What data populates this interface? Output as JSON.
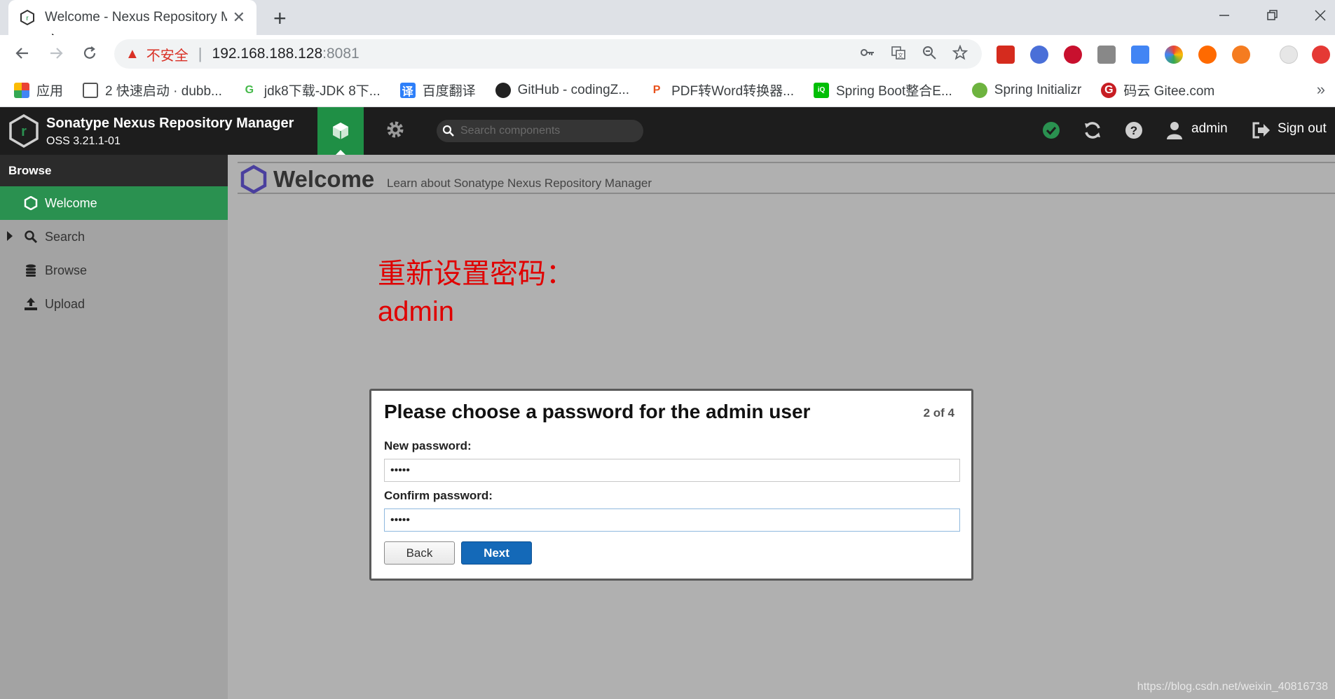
{
  "browser": {
    "tab_title": "Welcome - Nexus Repository M",
    "new_tab_symbol": "+",
    "close_symbol": "✕",
    "insecure_label": "不安全",
    "url_host": "192.168.188.128",
    "url_port": ":8081",
    "bookmarks": [
      {
        "label": "应用",
        "icon": "apps-grid-icon"
      },
      {
        "label": "2 快速启动 · dubb...",
        "icon": "book-icon"
      },
      {
        "label": "jdk8下载-JDK 8下...",
        "icon": "g-logo-icon"
      },
      {
        "label": "百度翻译",
        "icon": "translate-icon"
      },
      {
        "label": "GitHub - codingZ...",
        "icon": "github-icon"
      },
      {
        "label": "PDF转Word转换器...",
        "icon": "pdf-icon"
      },
      {
        "label": "Spring Boot整合E...",
        "icon": "iqiyi-icon"
      },
      {
        "label": "Spring Initializr",
        "icon": "spring-icon"
      },
      {
        "label": "码云 Gitee.com",
        "icon": "gitee-icon"
      }
    ],
    "more_bookmarks": "»"
  },
  "nexus": {
    "app_title": "Sonatype Nexus Repository Manager",
    "version": "OSS 3.21.1-01",
    "search_placeholder": "Search components",
    "user": "admin",
    "sign_out": "Sign out"
  },
  "sidebar": {
    "header": "Browse",
    "items": [
      {
        "label": "Welcome",
        "active": true,
        "icon": "hexagon-icon"
      },
      {
        "label": "Search",
        "active": false,
        "icon": "search-icon"
      },
      {
        "label": "Browse",
        "active": false,
        "icon": "database-icon"
      },
      {
        "label": "Upload",
        "active": false,
        "icon": "upload-icon"
      }
    ]
  },
  "main": {
    "title": "Welcome",
    "subtitle": "Learn about Sonatype Nexus Repository Manager",
    "annotation_line1": "重新设置密码：",
    "annotation_line2": "admin"
  },
  "dialog": {
    "title": "Please choose a password for the admin user",
    "step": "2 of 4",
    "new_password_label": "New password:",
    "new_password_value": "admin",
    "confirm_password_label": "Confirm password:",
    "confirm_password_value": "admin",
    "back_label": "Back",
    "next_label": "Next"
  },
  "watermark": "https://blog.csdn.net/weixin_40816738",
  "colors": {
    "nexus_green": "#2a9150",
    "header_dark": "#1d1d1d",
    "next_blue": "#1469b8",
    "annotation_red": "#e00000"
  }
}
